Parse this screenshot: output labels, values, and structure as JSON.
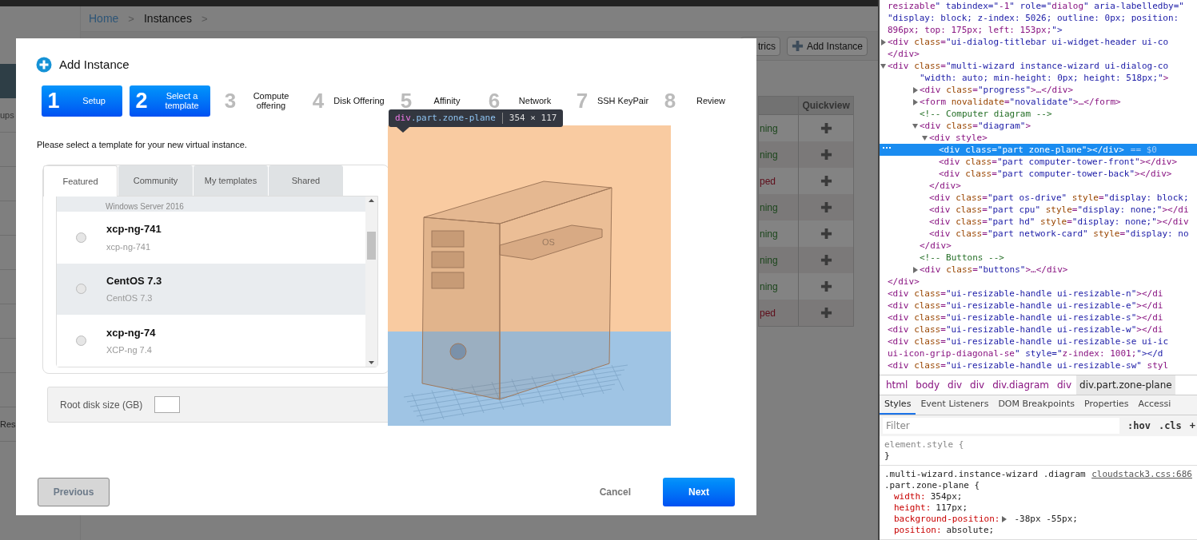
{
  "background_app": {
    "sidebar_items": [
      {
        "label": "ups"
      },
      {
        "label": "Res"
      }
    ],
    "breadcrumb": [
      {
        "label": "Home",
        "kind": "link"
      },
      {
        "label": ">",
        "kind": "separator"
      },
      {
        "label": "Instances",
        "kind": "current"
      },
      {
        "label": ">",
        "kind": "separator"
      }
    ],
    "toolbar_buttons": [
      {
        "label": "trics",
        "kind": "plain"
      },
      {
        "label": "Add Instance",
        "kind": "add"
      }
    ],
    "table": {
      "columns": [
        "Quickview"
      ],
      "rows": [
        {
          "status": "ning",
          "color": "#1c461c"
        },
        {
          "status": "ning",
          "color": "#1c461c"
        },
        {
          "status": "ped",
          "color": "#5e0d1a"
        },
        {
          "status": "ning",
          "color": "#1c461c"
        },
        {
          "status": "ning",
          "color": "#1c461c"
        },
        {
          "status": "ning",
          "color": "#1c461c"
        },
        {
          "status": "ning",
          "color": "#1c461c"
        },
        {
          "status": "ped",
          "color": "#5e0d1a"
        }
      ]
    }
  },
  "dialog": {
    "title": "Add Instance",
    "steps": [
      {
        "number": "1",
        "label": "Setup",
        "selected": true
      },
      {
        "number": "2",
        "label": "Select a template",
        "selected": true
      },
      {
        "number": "3",
        "label": "Compute offering",
        "selected": false
      },
      {
        "number": "4",
        "label": "Disk Offering",
        "selected": false
      },
      {
        "number": "5",
        "label": "Affinity",
        "selected": false
      },
      {
        "number": "6",
        "label": "Network",
        "selected": false
      },
      {
        "number": "7",
        "label": "SSH KeyPair",
        "selected": false
      },
      {
        "number": "8",
        "label": "Review",
        "selected": false
      }
    ],
    "instruction": "Please select a template for your new virtual instance.",
    "tabs": [
      {
        "label": "Featured",
        "selected": true
      },
      {
        "label": "Community",
        "selected": false
      },
      {
        "label": "My templates",
        "selected": false
      },
      {
        "label": "Shared",
        "selected": false
      }
    ],
    "templates": [
      {
        "kind": "partial",
        "description": "Windows Server 2016"
      },
      {
        "kind": "full",
        "name": "xcp-ng-741",
        "description": "xcp-ng-741",
        "selected": false
      },
      {
        "kind": "full",
        "name": "CentOS 7.3",
        "description": "CentOS 7.3",
        "selected": false
      },
      {
        "kind": "full",
        "name": "xcp-ng-74",
        "description": "XCP-ng 7.4",
        "selected": false
      }
    ],
    "root_disk": {
      "label": "Root disk size (GB)"
    },
    "buttons": {
      "previous": "Previous",
      "cancel": "Cancel",
      "next": "Next"
    },
    "diagram": {
      "drive_label": "OS"
    }
  },
  "inspect_tooltip": {
    "tag": "div",
    "classes": ".part.zone-plane",
    "size": "354 × 117"
  },
  "devtools": {
    "tree": [
      {
        "text": "resizable\" tabindex=\"-1\" role=\"dialog\" aria-labelledby=\""
      },
      {
        "text": "\"display: block; z-index: 5026; outline: 0px; position:"
      },
      {
        "text": "896px; top: 175px; left: 153px;\">"
      },
      {
        "text": "<div class=\"ui-dialog-titlebar ui-widget-header ui-co",
        "expanded": false
      },
      {
        "text": "</div>"
      },
      {
        "text": "<div class=\"multi-wizard instance-wizard ui-dialog-co",
        "expanded": true,
        "children": [
          {
            "text": "\"width: auto; min-height: 0px; height: 518px;\">"
          },
          {
            "text": "<div class=\"progress\">…</div>",
            "expanded": false
          },
          {
            "text": "<form novalidate=\"novalidate\">…</form>",
            "expanded": false
          },
          {
            "text": "<!-- Computer diagram -->"
          },
          {
            "text": "<div class=\"diagram\">",
            "expanded": true,
            "children": [
              {
                "text": "<div style>",
                "expanded": true,
                "children": [
                  {
                    "text": "<div class=\"part zone-plane\"></div>",
                    "selected": true,
                    "note": "== $0"
                  },
                  {
                    "text": "<div class=\"part computer-tower-front\"></div>"
                  },
                  {
                    "text": "<div class=\"part computer-tower-back\"></div>"
                  }
                ]
              },
              {
                "text": "</div>"
              },
              {
                "text": "<div class=\"part os-drive\" style=\"display: block;"
              },
              {
                "text": "<div class=\"part cpu\" style=\"display: none;\"></di"
              },
              {
                "text": "<div class=\"part hd\" style=\"display: none;\"></div"
              },
              {
                "text": "<div class=\"part network-card\" style=\"display: no"
              }
            ]
          },
          {
            "text": "</div>"
          },
          {
            "text": "<!-- Buttons -->"
          },
          {
            "text": "<div class=\"buttons\">…</div>",
            "expanded": false
          }
        ]
      },
      {
        "text": "</div>"
      },
      {
        "text": "<div class=\"ui-resizable-handle ui-resizable-n\"></di"
      },
      {
        "text": "<div class=\"ui-resizable-handle ui-resizable-e\"></di"
      },
      {
        "text": "<div class=\"ui-resizable-handle ui-resizable-s\"></di"
      },
      {
        "text": "<div class=\"ui-resizable-handle ui-resizable-w\"></di"
      },
      {
        "text": "<div class=\"ui-resizable-handle ui-resizable-se ui-ic"
      },
      {
        "text": "ui-icon-grip-diagonal-se\" style=\"z-index: 1001;\"></d"
      },
      {
        "text": "<div class=\"ui-resizable-handle ui-resizable-sw\" styl"
      }
    ],
    "breadcrumbs": [
      {
        "label": "html",
        "selected": false
      },
      {
        "label": "body",
        "selected": false
      },
      {
        "label": "div",
        "selected": false
      },
      {
        "label": "div",
        "selected": false
      },
      {
        "label": "div.diagram",
        "selected": false
      },
      {
        "label": "div",
        "selected": false
      },
      {
        "label": "div.part.zone-plane",
        "selected": true
      }
    ],
    "tabs": [
      {
        "label": "Styles",
        "selected": true
      },
      {
        "label": "Event Listeners",
        "selected": false
      },
      {
        "label": "DOM Breakpoints",
        "selected": false
      },
      {
        "label": "Properties",
        "selected": false
      },
      {
        "label": "Accessi",
        "selected": false
      }
    ],
    "filter": {
      "placeholder": "Filter",
      "buttons": [
        ":hov",
        ".cls",
        "+"
      ]
    },
    "rules": [
      {
        "selector": "element.style {",
        "close": "}"
      },
      {
        "selector": ".multi-wizard.instance-wizard .diagram",
        "source": "cloudstack3.css:686",
        "selector_rest": ".part.zone-plane {",
        "properties": [
          {
            "name": "width:",
            "value": "354px;",
            "expandable": false
          },
          {
            "name": "height:",
            "value": "117px;",
            "expandable": false
          },
          {
            "name": "background-position:",
            "value": "-38px -55px;",
            "expandable": true
          },
          {
            "name": "position:",
            "value": "absolute;",
            "expandable": false
          }
        ]
      }
    ]
  }
}
